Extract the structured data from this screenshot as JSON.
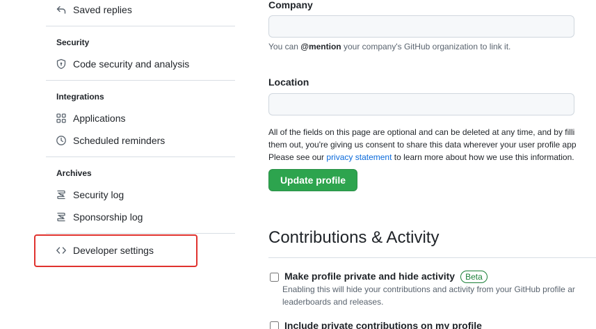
{
  "sidebar": {
    "saved_replies": "Saved replies",
    "security": {
      "title": "Security",
      "items": [
        "Code security and analysis"
      ]
    },
    "integrations": {
      "title": "Integrations",
      "items": [
        "Applications",
        "Scheduled reminders"
      ]
    },
    "archives": {
      "title": "Archives",
      "items": [
        "Security log",
        "Sponsorship log"
      ]
    },
    "developer_settings": "Developer settings"
  },
  "profile": {
    "company": {
      "label": "Company",
      "value": "",
      "note_prefix": "You can ",
      "note_mention": "@mention",
      "note_suffix": " your company's GitHub organization to link it."
    },
    "location": {
      "label": "Location",
      "value": ""
    },
    "consent": {
      "line1": "All of the fields on this page are optional and can be deleted at any time, and by filli",
      "line2": "them out, you're giving us consent to share this data wherever your user profile app",
      "line3_prefix": "Please see our ",
      "privacy_link": "privacy statement",
      "line3_suffix": " to learn more about how we use this information."
    },
    "update_button": "Update profile"
  },
  "contributions": {
    "title": "Contributions & Activity",
    "private_profile": {
      "label": "Make profile private and hide activity",
      "badge": "Beta",
      "desc_line1": "Enabling this will hide your contributions and activity from your GitHub profile ar",
      "desc_line2": "leaderboards and releases.",
      "checked": false
    },
    "private_contributions": {
      "label": "Include private contributions on my profile",
      "checked": false
    }
  },
  "colors": {
    "accent_green": "#2da44e",
    "link_blue": "#0969da",
    "highlight_red": "#e0322e"
  }
}
